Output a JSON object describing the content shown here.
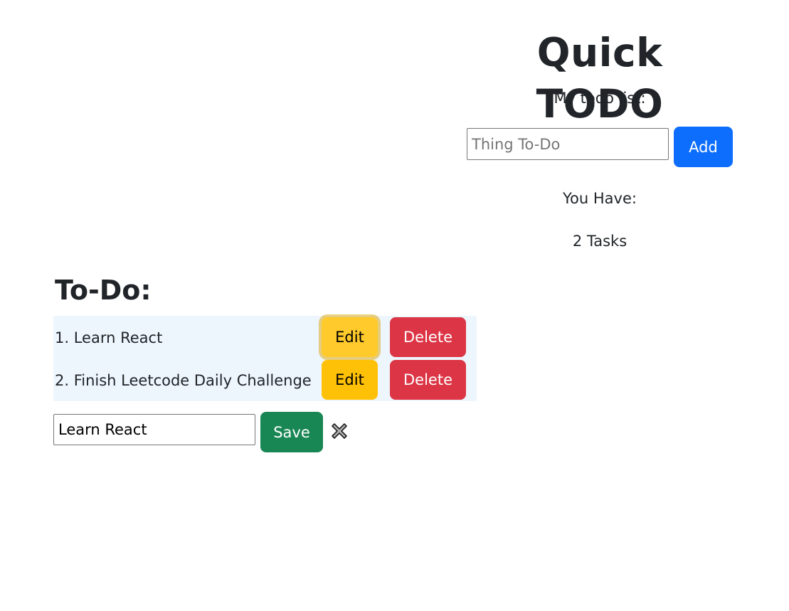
{
  "header": {
    "title": "Quick TODO",
    "subtitle": "My todo list:"
  },
  "add_form": {
    "placeholder": "Thing To-Do",
    "value": "",
    "add_label": "Add"
  },
  "summary": {
    "you_have_label": "You Have:",
    "task_count_text": "2 Tasks"
  },
  "todo_section": {
    "heading": "To-Do:",
    "items": [
      {
        "text": "1. Learn React",
        "edit_label": "Edit",
        "delete_label": "Delete"
      },
      {
        "text": "2. Finish Leetcode Daily Challenge",
        "edit_label": "Edit",
        "delete_label": "Delete"
      }
    ]
  },
  "edit_form": {
    "value": "Learn React",
    "save_label": "Save",
    "cancel_icon": "close-x-icon"
  },
  "colors": {
    "primary": "#0d6efd",
    "warning": "#ffc107",
    "danger": "#dc3545",
    "success": "#198754",
    "row_background": "#eef6fd"
  }
}
